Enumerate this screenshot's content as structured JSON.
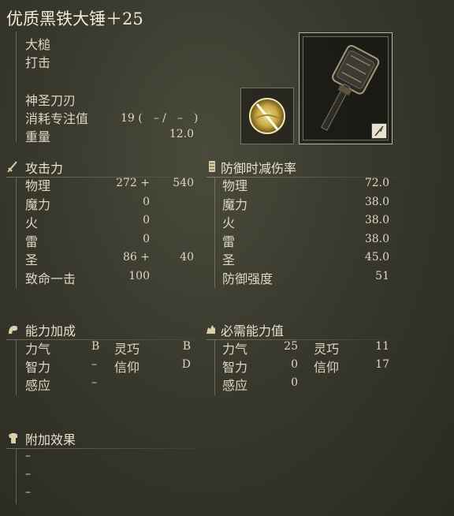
{
  "item": {
    "name": "优质黑铁大锤＋25",
    "weapon_type": "大槌",
    "attack_type": "打击",
    "skill": "神圣刀刃",
    "fp_cost_label": "消耗专注值",
    "fp_cost_value": "19 (　– /　–　)",
    "weight_label": "重量",
    "weight_value": "12.0"
  },
  "attack": {
    "header": "攻击力",
    "rows": [
      {
        "label": "物理",
        "base": "272 +",
        "bonus": "540"
      },
      {
        "label": "魔力",
        "base": "0",
        "bonus": ""
      },
      {
        "label": "火",
        "base": "0",
        "bonus": ""
      },
      {
        "label": "雷",
        "base": "0",
        "bonus": ""
      },
      {
        "label": "圣",
        "base": "86 +",
        "bonus": "40"
      },
      {
        "label": "致命一击",
        "base": "100",
        "bonus": ""
      }
    ]
  },
  "guard": {
    "header": "防御时减伤率",
    "rows": [
      {
        "label": "物理",
        "value": "72.0"
      },
      {
        "label": "魔力",
        "value": "38.0"
      },
      {
        "label": "火",
        "value": "38.0"
      },
      {
        "label": "雷",
        "value": "38.0"
      },
      {
        "label": "圣",
        "value": "45.0"
      },
      {
        "label": "防御强度",
        "value": "51"
      }
    ]
  },
  "scaling": {
    "header": "能力加成",
    "rows": [
      {
        "a_label": "力气",
        "a_val": "B",
        "b_label": "灵巧",
        "b_val": "B"
      },
      {
        "a_label": "智力",
        "a_val": "–",
        "b_label": "信仰",
        "b_val": "D"
      },
      {
        "a_label": "感应",
        "a_val": "–",
        "b_label": "",
        "b_val": ""
      }
    ]
  },
  "requirements": {
    "header": "必需能力值",
    "rows": [
      {
        "a_label": "力气",
        "a_val": "25",
        "b_label": "灵巧",
        "b_val": "11"
      },
      {
        "a_label": "智力",
        "a_val": "0",
        "b_label": "信仰",
        "b_val": "17"
      },
      {
        "a_label": "感应",
        "a_val": "0",
        "b_label": "",
        "b_val": ""
      }
    ]
  },
  "passive": {
    "header": "附加效果",
    "rows": [
      "–",
      "–",
      "–"
    ]
  },
  "icons": {
    "attack": "sword-icon",
    "guard": "shield-icon",
    "scaling": "flexed-arm-icon",
    "requirements": "hand-icon",
    "passive": "armor-icon",
    "ash": "holy-blade-ash-icon",
    "weapon": "great-hammer-icon",
    "affinity": "quill-icon"
  }
}
